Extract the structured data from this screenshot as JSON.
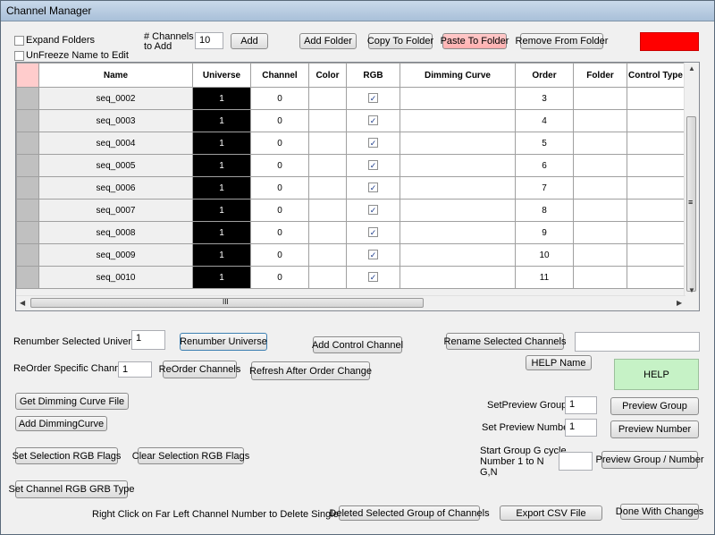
{
  "window": {
    "title": "Channel Manager"
  },
  "top": {
    "expand_folders": "Expand Folders",
    "unfreeze": "UnFreeze Name to Edit",
    "channels_to_add_label": "# Channels\nto Add",
    "channels_to_add_value": "10",
    "add": "Add",
    "add_folder": "Add Folder",
    "copy_to_folder": "Copy To Folder",
    "paste_to_folder": "Paste To Folder",
    "remove_from_folder": "Remove From Folder",
    "status_color": "#ff0000"
  },
  "grid": {
    "columns": [
      "Name",
      "Universe",
      "Channel",
      "Color",
      "RGB",
      "Dimming Curve",
      "Order",
      "Folder",
      "Control Type"
    ],
    "rows": [
      {
        "name": "seq_0002",
        "universe": "1",
        "channel": "0",
        "rgb": "✓",
        "order": "3"
      },
      {
        "name": "seq_0003",
        "universe": "1",
        "channel": "0",
        "rgb": "✓",
        "order": "4"
      },
      {
        "name": "seq_0004",
        "universe": "1",
        "channel": "0",
        "rgb": "✓",
        "order": "5"
      },
      {
        "name": "seq_0005",
        "universe": "1",
        "channel": "0",
        "rgb": "✓",
        "order": "6"
      },
      {
        "name": "seq_0006",
        "universe": "1",
        "channel": "0",
        "rgb": "✓",
        "order": "7"
      },
      {
        "name": "seq_0007",
        "universe": "1",
        "channel": "0",
        "rgb": "✓",
        "order": "8"
      },
      {
        "name": "seq_0008",
        "universe": "1",
        "channel": "0",
        "rgb": "✓",
        "order": "9"
      },
      {
        "name": "seq_0009",
        "universe": "1",
        "channel": "0",
        "rgb": "✓",
        "order": "10"
      },
      {
        "name": "seq_0010",
        "universe": "1",
        "channel": "0",
        "rgb": "✓",
        "order": "11"
      }
    ],
    "hscroll_grip": "III",
    "vscroll_grip": "≡"
  },
  "controls": {
    "renumber_label": "Renumber Selected Universe",
    "renumber_value": "1",
    "renumber_button": "Renumber Universe",
    "add_control_channel": "Add Control Channel",
    "rename_selected": "Rename Selected Channels",
    "rename_value": "",
    "reorder_label": "ReOrder Specific Channels",
    "reorder_value": "1",
    "reorder_button": "ReOrder Channels",
    "refresh_after_order": "Refresh After Order Change",
    "help_name": "HELP Name",
    "help": "HELP",
    "get_dimming_curve": "Get Dimming Curve File",
    "add_dimming_curve": "Add DimmingCurve",
    "set_preview_group_label": "SetPreview Group",
    "set_preview_group_value": "1",
    "preview_group": "Preview Group",
    "set_preview_number_label": "Set Preview Number",
    "set_preview_number_value": "1",
    "preview_number": "Preview Number",
    "set_rgb_flags": "Set Selection RGB Flags",
    "clear_rgb_flags": "Clear Selection RGB Flags",
    "start_group_label_1": "Start Group G cycle",
    "start_group_label_2": "Number 1 to N",
    "start_group_label_3": "G,N",
    "start_group_value": "",
    "preview_group_number": "Preview Group / Number",
    "set_rgb_grb": "Set Channel RGB GRB Type",
    "right_click_note": "Right Click on Far Left Channel Number to Delete Single Channel",
    "delete_group": "Deleted Selected Group of Channels",
    "export_csv": "Export CSV File",
    "done": "Done With Changes"
  }
}
